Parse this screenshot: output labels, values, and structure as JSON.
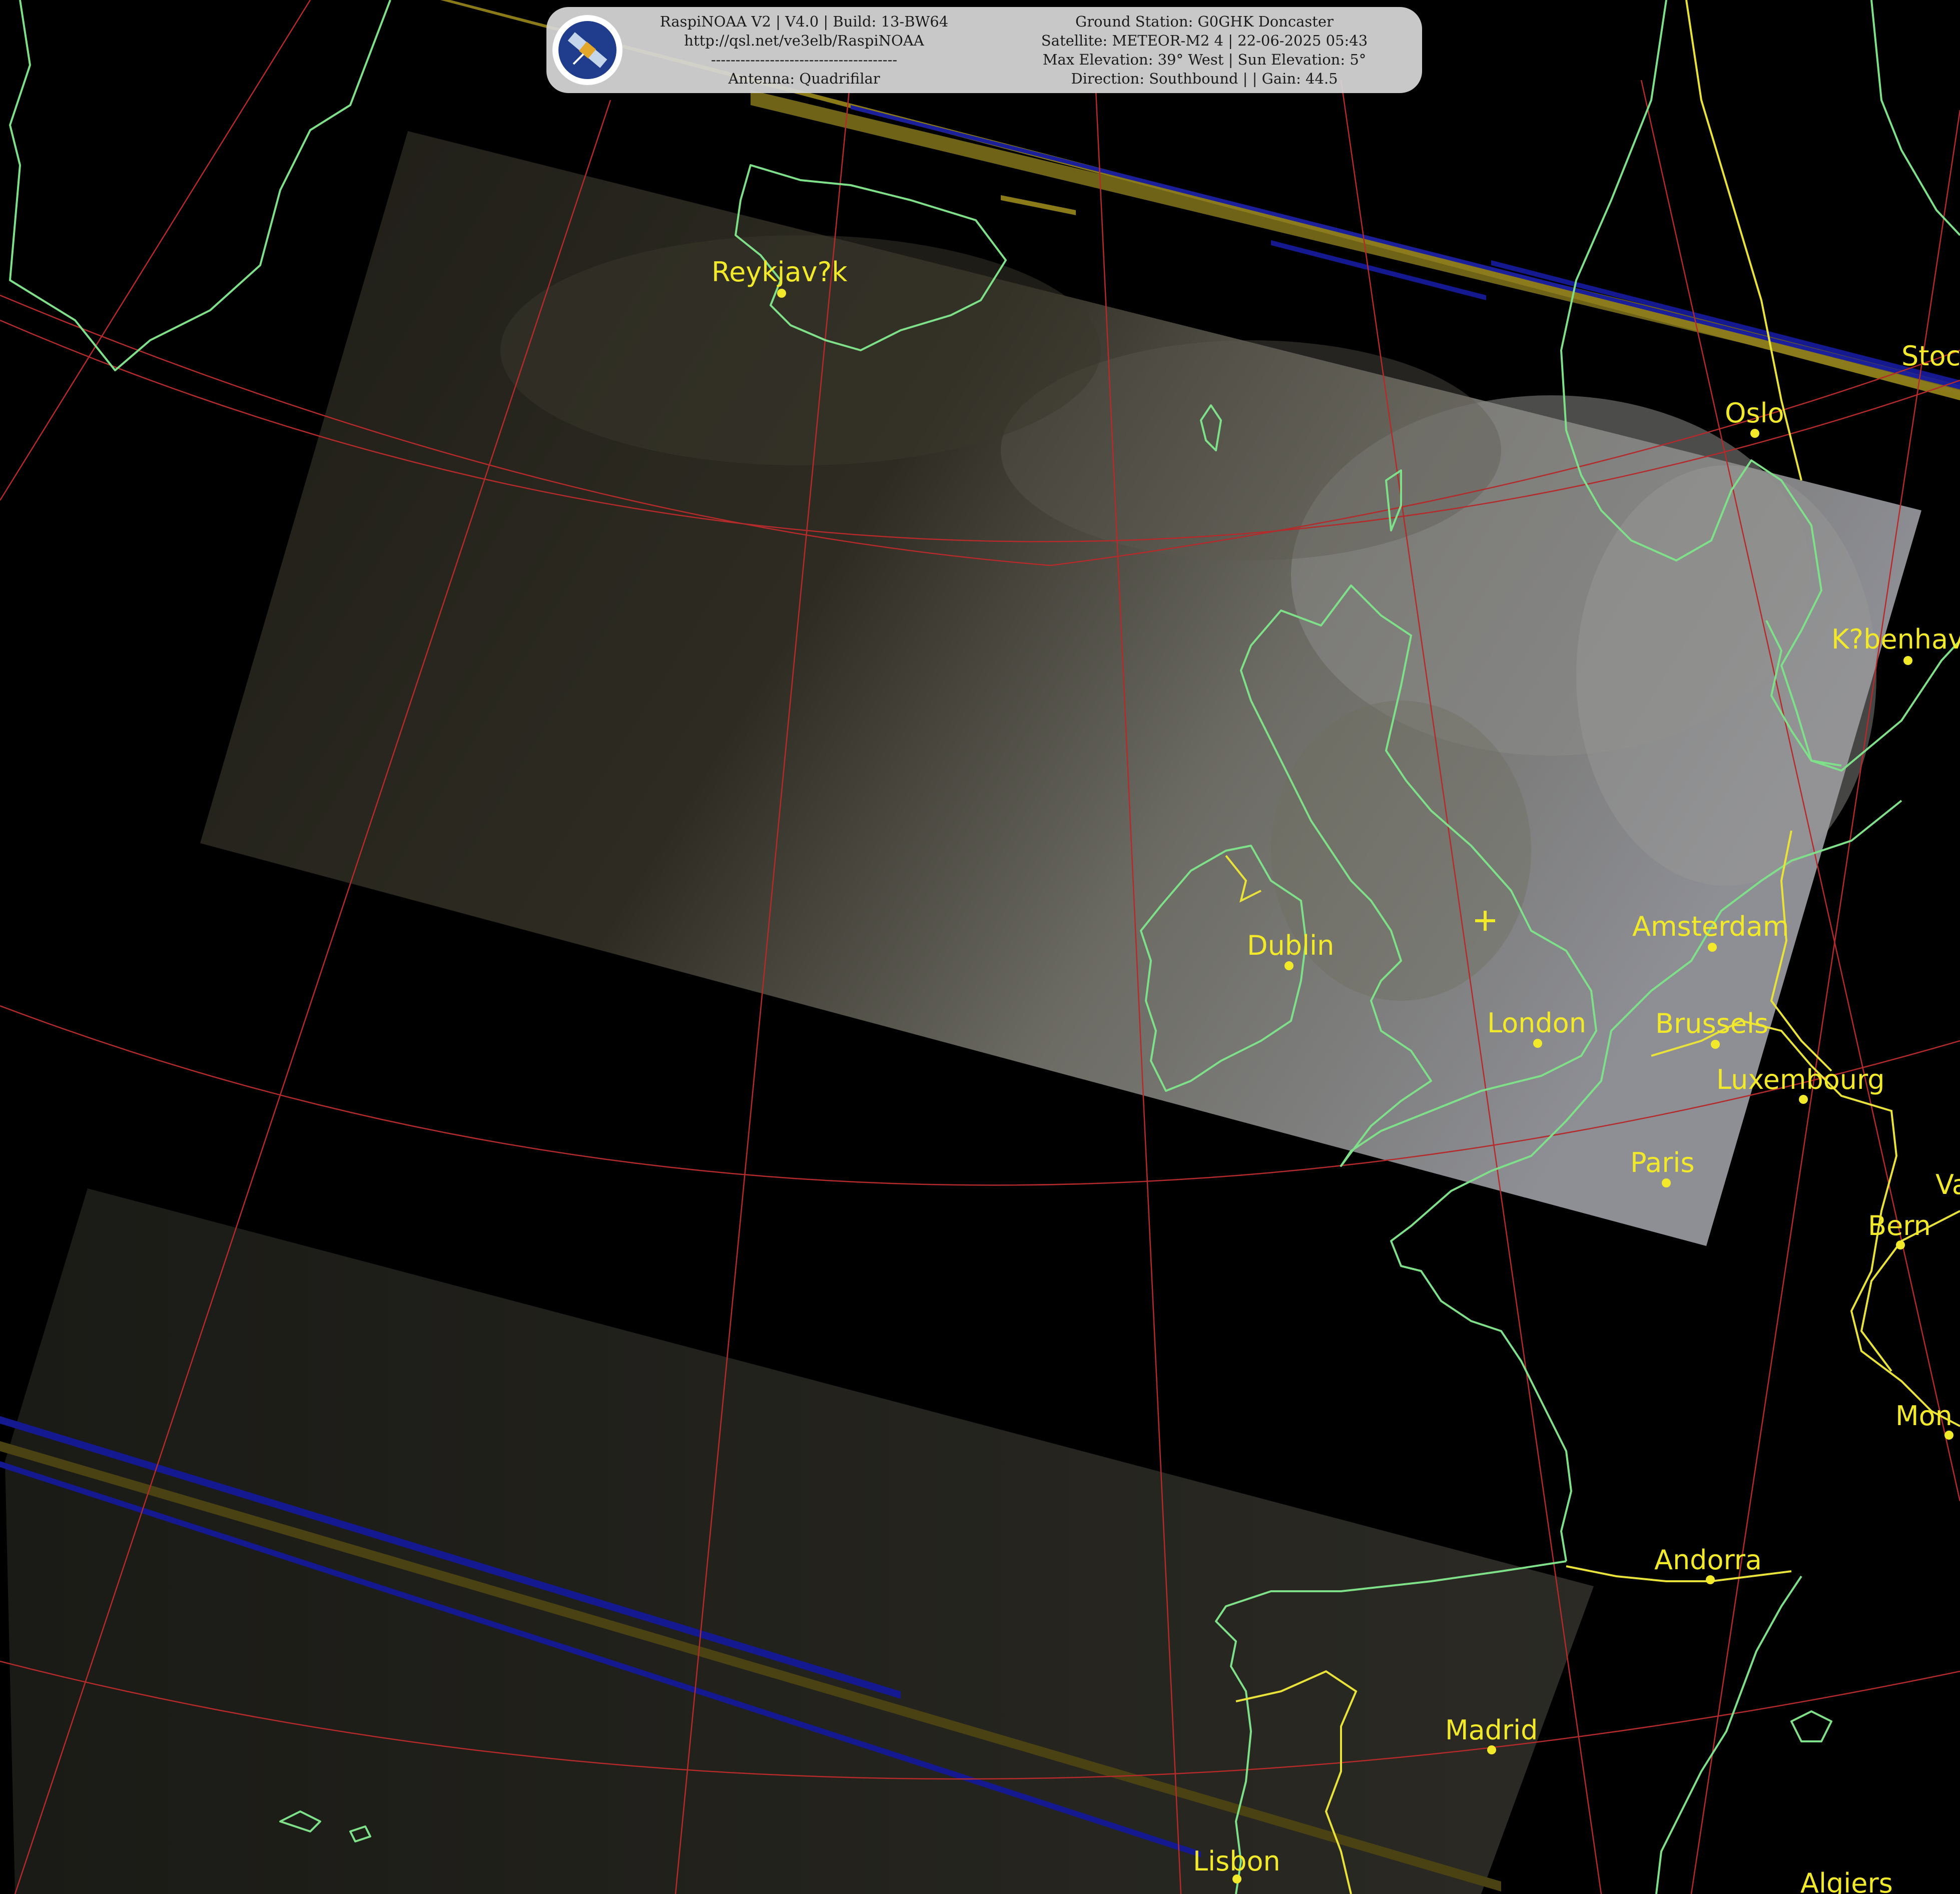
{
  "banner": {
    "software": "RaspiNOAA V2 | V4.0 | Build: 13-BW64",
    "url": "http://qsl.net/ve3elb/RaspiNOAA",
    "divider": "--------------------------------------",
    "antenna": "Antenna: Quadrifilar",
    "ground_station": "Ground Station: G0GHK Doncaster",
    "satellite": "Satellite: METEOR-M2 4 | 22-06-2025 05:43",
    "elevation": "Max Elevation: 39° West | Sun Elevation: 5°",
    "direction": "Direction: Southbound | | Gain: 44.5",
    "logo_icon": "satellite-icon"
  },
  "cities": [
    {
      "name": "Reykjav?k"
    },
    {
      "name": "Oslo"
    },
    {
      "name": "Stoc"
    },
    {
      "name": "K?benhav"
    },
    {
      "name": "Dublin"
    },
    {
      "name": "Amsterdam"
    },
    {
      "name": "London"
    },
    {
      "name": "Brussels"
    },
    {
      "name": "Luxembourg"
    },
    {
      "name": "Paris"
    },
    {
      "name": "Bern"
    },
    {
      "name": "Mon"
    },
    {
      "name": "Andorra"
    },
    {
      "name": "Madrid"
    },
    {
      "name": "Lisbon"
    },
    {
      "name": "Algiers"
    },
    {
      "name": "Va"
    }
  ],
  "colors": {
    "coastline": "#7fe08a",
    "borders": "#e8e23a",
    "graticule": "#b52a2a",
    "labels": "#f2e92a",
    "background": "#000000"
  }
}
